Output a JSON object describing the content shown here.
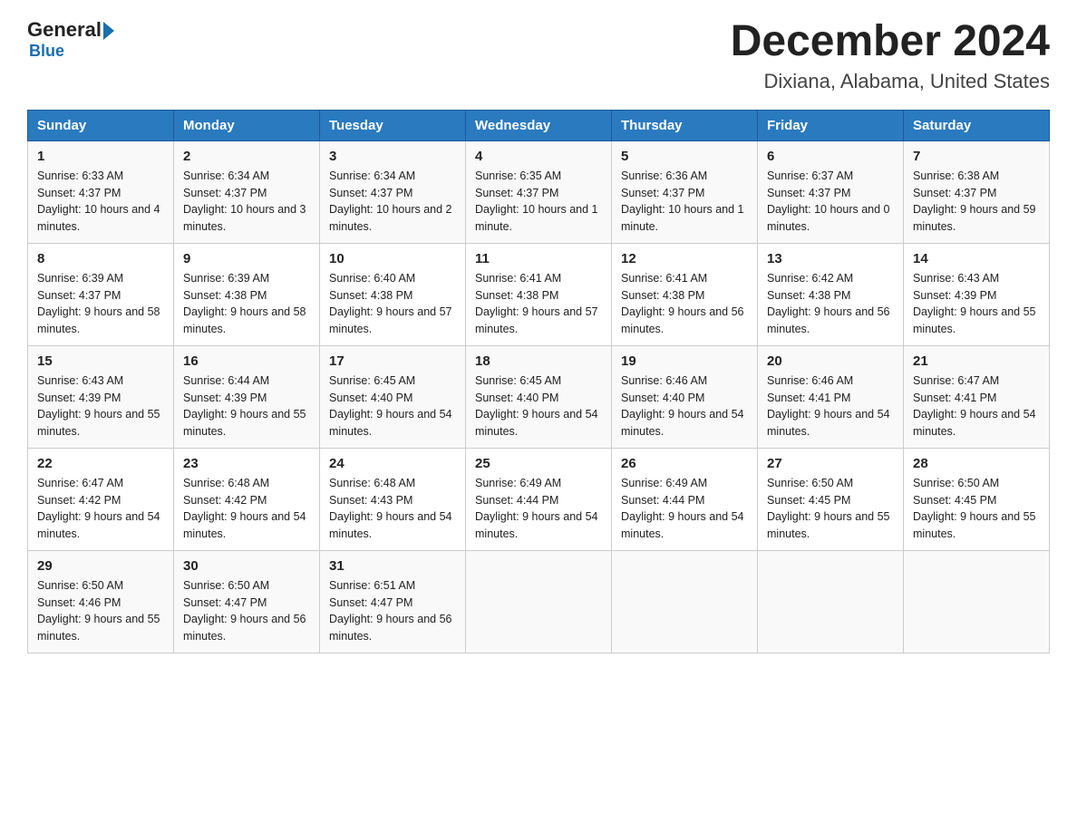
{
  "header": {
    "logo_general": "General",
    "logo_blue": "Blue",
    "month_title": "December 2024",
    "location": "Dixiana, Alabama, United States"
  },
  "days_of_week": [
    "Sunday",
    "Monday",
    "Tuesday",
    "Wednesday",
    "Thursday",
    "Friday",
    "Saturday"
  ],
  "weeks": [
    [
      {
        "day": "1",
        "sunrise": "6:33 AM",
        "sunset": "4:37 PM",
        "daylight": "10 hours and 4 minutes."
      },
      {
        "day": "2",
        "sunrise": "6:34 AM",
        "sunset": "4:37 PM",
        "daylight": "10 hours and 3 minutes."
      },
      {
        "day": "3",
        "sunrise": "6:34 AM",
        "sunset": "4:37 PM",
        "daylight": "10 hours and 2 minutes."
      },
      {
        "day": "4",
        "sunrise": "6:35 AM",
        "sunset": "4:37 PM",
        "daylight": "10 hours and 1 minute."
      },
      {
        "day": "5",
        "sunrise": "6:36 AM",
        "sunset": "4:37 PM",
        "daylight": "10 hours and 1 minute."
      },
      {
        "day": "6",
        "sunrise": "6:37 AM",
        "sunset": "4:37 PM",
        "daylight": "10 hours and 0 minutes."
      },
      {
        "day": "7",
        "sunrise": "6:38 AM",
        "sunset": "4:37 PM",
        "daylight": "9 hours and 59 minutes."
      }
    ],
    [
      {
        "day": "8",
        "sunrise": "6:39 AM",
        "sunset": "4:37 PM",
        "daylight": "9 hours and 58 minutes."
      },
      {
        "day": "9",
        "sunrise": "6:39 AM",
        "sunset": "4:38 PM",
        "daylight": "9 hours and 58 minutes."
      },
      {
        "day": "10",
        "sunrise": "6:40 AM",
        "sunset": "4:38 PM",
        "daylight": "9 hours and 57 minutes."
      },
      {
        "day": "11",
        "sunrise": "6:41 AM",
        "sunset": "4:38 PM",
        "daylight": "9 hours and 57 minutes."
      },
      {
        "day": "12",
        "sunrise": "6:41 AM",
        "sunset": "4:38 PM",
        "daylight": "9 hours and 56 minutes."
      },
      {
        "day": "13",
        "sunrise": "6:42 AM",
        "sunset": "4:38 PM",
        "daylight": "9 hours and 56 minutes."
      },
      {
        "day": "14",
        "sunrise": "6:43 AM",
        "sunset": "4:39 PM",
        "daylight": "9 hours and 55 minutes."
      }
    ],
    [
      {
        "day": "15",
        "sunrise": "6:43 AM",
        "sunset": "4:39 PM",
        "daylight": "9 hours and 55 minutes."
      },
      {
        "day": "16",
        "sunrise": "6:44 AM",
        "sunset": "4:39 PM",
        "daylight": "9 hours and 55 minutes."
      },
      {
        "day": "17",
        "sunrise": "6:45 AM",
        "sunset": "4:40 PM",
        "daylight": "9 hours and 54 minutes."
      },
      {
        "day": "18",
        "sunrise": "6:45 AM",
        "sunset": "4:40 PM",
        "daylight": "9 hours and 54 minutes."
      },
      {
        "day": "19",
        "sunrise": "6:46 AM",
        "sunset": "4:40 PM",
        "daylight": "9 hours and 54 minutes."
      },
      {
        "day": "20",
        "sunrise": "6:46 AM",
        "sunset": "4:41 PM",
        "daylight": "9 hours and 54 minutes."
      },
      {
        "day": "21",
        "sunrise": "6:47 AM",
        "sunset": "4:41 PM",
        "daylight": "9 hours and 54 minutes."
      }
    ],
    [
      {
        "day": "22",
        "sunrise": "6:47 AM",
        "sunset": "4:42 PM",
        "daylight": "9 hours and 54 minutes."
      },
      {
        "day": "23",
        "sunrise": "6:48 AM",
        "sunset": "4:42 PM",
        "daylight": "9 hours and 54 minutes."
      },
      {
        "day": "24",
        "sunrise": "6:48 AM",
        "sunset": "4:43 PM",
        "daylight": "9 hours and 54 minutes."
      },
      {
        "day": "25",
        "sunrise": "6:49 AM",
        "sunset": "4:44 PM",
        "daylight": "9 hours and 54 minutes."
      },
      {
        "day": "26",
        "sunrise": "6:49 AM",
        "sunset": "4:44 PM",
        "daylight": "9 hours and 54 minutes."
      },
      {
        "day": "27",
        "sunrise": "6:50 AM",
        "sunset": "4:45 PM",
        "daylight": "9 hours and 55 minutes."
      },
      {
        "day": "28",
        "sunrise": "6:50 AM",
        "sunset": "4:45 PM",
        "daylight": "9 hours and 55 minutes."
      }
    ],
    [
      {
        "day": "29",
        "sunrise": "6:50 AM",
        "sunset": "4:46 PM",
        "daylight": "9 hours and 55 minutes."
      },
      {
        "day": "30",
        "sunrise": "6:50 AM",
        "sunset": "4:47 PM",
        "daylight": "9 hours and 56 minutes."
      },
      {
        "day": "31",
        "sunrise": "6:51 AM",
        "sunset": "4:47 PM",
        "daylight": "9 hours and 56 minutes."
      },
      null,
      null,
      null,
      null
    ]
  ],
  "labels": {
    "sunrise": "Sunrise:",
    "sunset": "Sunset:",
    "daylight": "Daylight:"
  }
}
